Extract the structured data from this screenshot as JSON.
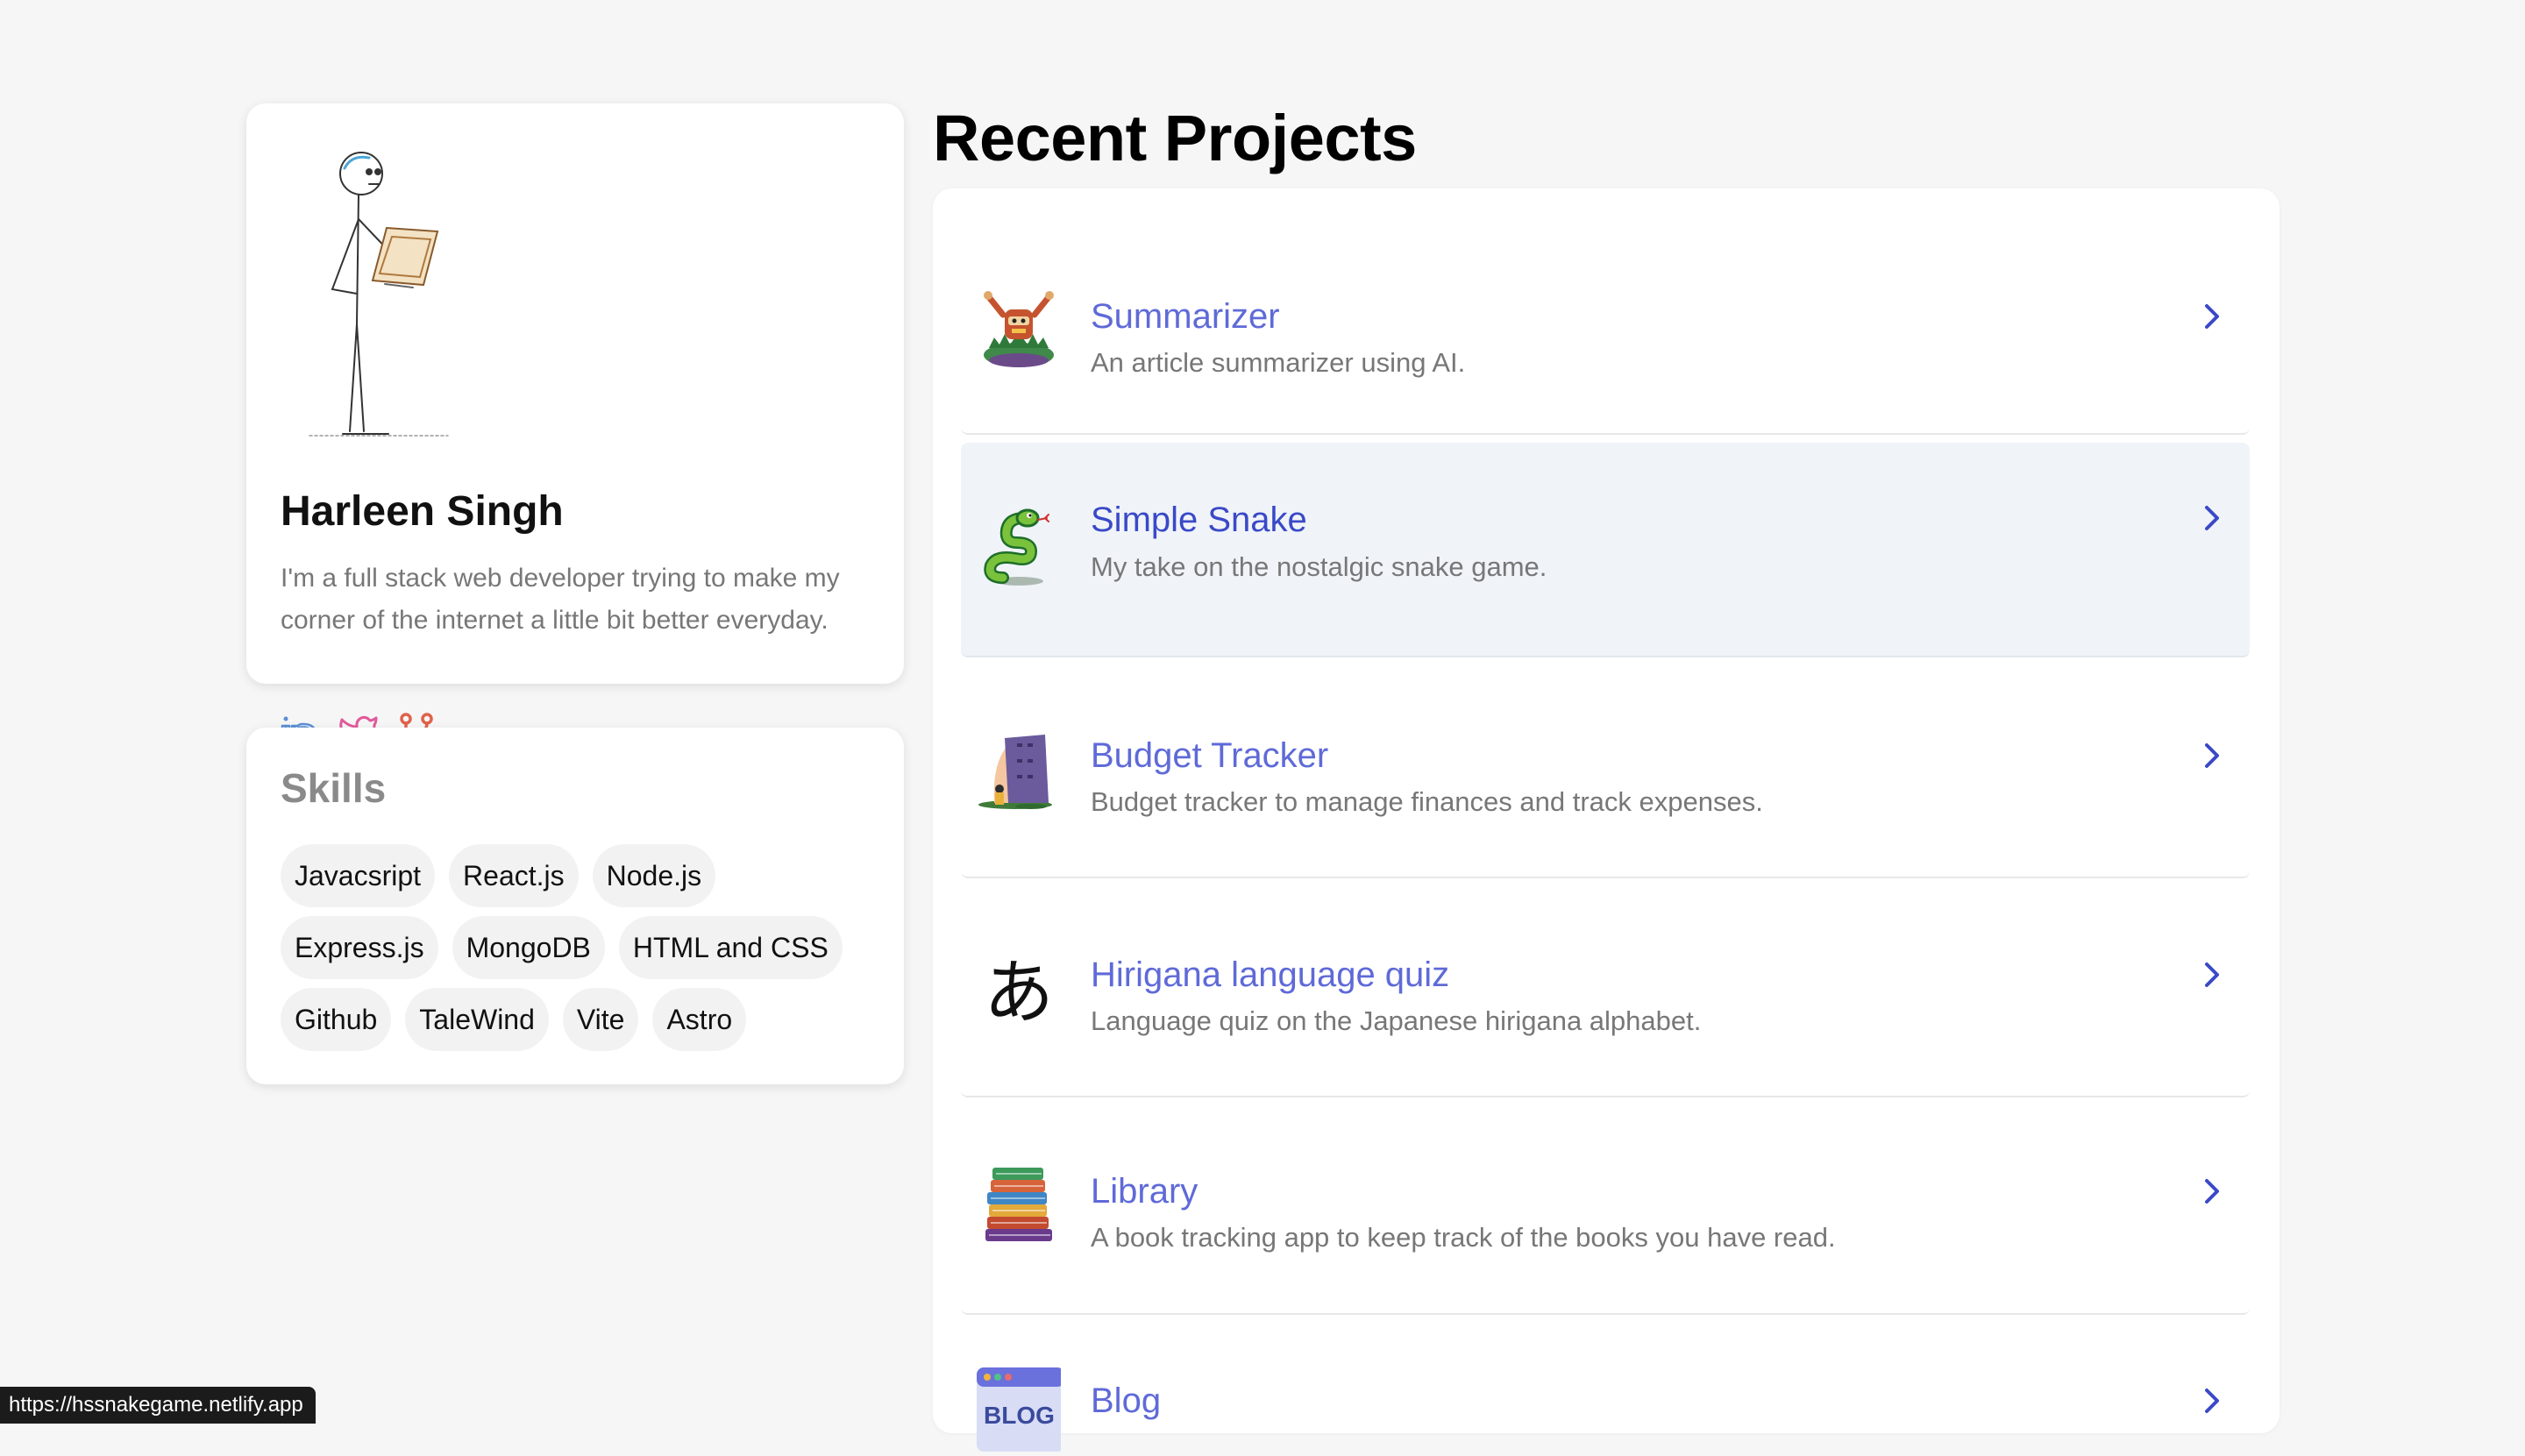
{
  "profile": {
    "name": "Harleen Singh",
    "bio": "I'm a full stack web developer trying to make my corner of the internet a little bit better everyday.",
    "social_icons": [
      "linkedin-icon",
      "twitter-icon",
      "fork-icon"
    ]
  },
  "skills": {
    "title": "Skills",
    "items": [
      "Javacsript",
      "React.js",
      "Node.js",
      "Express.js",
      "MongoDB",
      "HTML and CSS",
      "Github",
      "TaleWind",
      "Vite",
      "Astro"
    ]
  },
  "projects": {
    "title": "Recent Projects",
    "items": [
      {
        "title": "Summarizer",
        "desc": "An article summarizer using AI.",
        "icon": "robot-icon"
      },
      {
        "title": "Simple Snake",
        "desc": "My take on the nostalgic snake game.",
        "icon": "snake-icon"
      },
      {
        "title": "Budget Tracker",
        "desc": "Budget tracker to manage finances and track expenses.",
        "icon": "tower-icon"
      },
      {
        "title": "Hirigana language quiz",
        "desc": "Language quiz on the Japanese hirigana alphabet.",
        "icon": "hiragana-icon"
      },
      {
        "title": "Library",
        "desc": "A book tracking app to keep track of the books you have read.",
        "icon": "books-icon"
      },
      {
        "title": "Blog",
        "desc": "",
        "icon": "blog-icon"
      }
    ]
  },
  "hiragana_glyph": "あ",
  "blog_icon_text": "BLOG",
  "status_url": "https://hssnakegame.netlify.app",
  "colors": {
    "accent": "#5f6ad8",
    "accent_hover": "#3a49c7",
    "hover_bg": "#f0f4f9",
    "background": "#f6f6f6"
  }
}
